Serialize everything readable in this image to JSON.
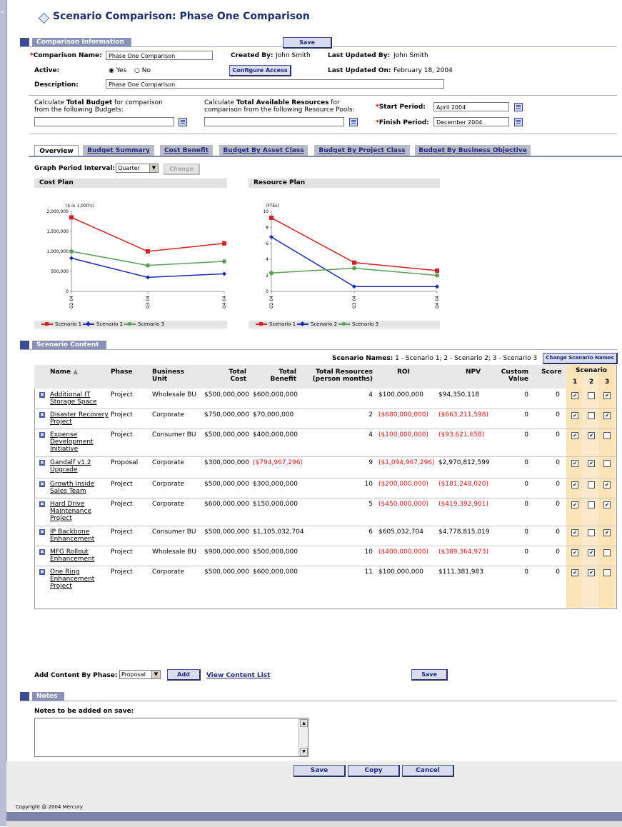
{
  "page": {
    "title": "Scenario Comparison: Phase One Comparison"
  },
  "comparison_info": {
    "header": "Comparison Information",
    "save": "Save",
    "name_label": "Comparison Name:",
    "name_value": "Phase One Comparison",
    "created_by_label": "Created By:",
    "created_by_value": "John Smith",
    "last_updated_by_label": "Last Updated By:",
    "last_updated_by_value": "John Smith",
    "active_label": "Active:",
    "active_yes": "Yes",
    "active_no": "No",
    "configure_access": "Configure Access",
    "last_updated_on_label": "Last Updated On:",
    "last_updated_on_value": "February 18, 2004",
    "description_label": "Description:",
    "description_value": "Phase One Comparison"
  },
  "budget": {
    "budget_text_pre": "Calculate ",
    "budget_text_bold": "Total Budget",
    "budget_text_post": " for comparison",
    "budget_text_line2": "from the following Budgets:",
    "res_text_pre": "Calculate ",
    "res_text_bold": "Total Available Resources",
    "res_text_post": " for",
    "res_text_line2": "comparison from the following Resource Pools:",
    "start_label": "Start Period:",
    "start_value": "April 2004",
    "finish_label": "Finish Period:",
    "finish_value": "December 2004"
  },
  "tabs": [
    "Overview",
    "Budget Summary",
    "Cost Benefit",
    "Budget By Asset Class",
    "Budget By Project Class",
    "Budget By Business Objective"
  ],
  "graph_interval": {
    "label": "Graph Period Interval:",
    "value": "Quarter",
    "change": "Change"
  },
  "chart_data": [
    {
      "type": "line",
      "title": "Cost Plan",
      "ylabel": "($ in 1,000's)",
      "categories": [
        "Q2 04",
        "Q3 04",
        "Q4 04"
      ],
      "yticks": [
        "0",
        "500,000",
        "1,000,000",
        "1,500,000",
        "2,000,000"
      ],
      "ylim": [
        0,
        2000000
      ],
      "series": [
        {
          "name": "Scenario 1",
          "color": "#d21f1f",
          "values": [
            1850000,
            1000000,
            1200000
          ]
        },
        {
          "name": "Scenario 2",
          "color": "#1a2bb0",
          "values": [
            830000,
            350000,
            440000
          ]
        },
        {
          "name": "Scenario 3",
          "color": "#5a9e5a",
          "values": [
            1000000,
            650000,
            750000
          ]
        }
      ]
    },
    {
      "type": "line",
      "title": "Resource Plan",
      "ylabel": "(FTEs)",
      "categories": [
        "Q2 04",
        "Q3 04",
        "Q4 04"
      ],
      "yticks": [
        "0",
        "2",
        "4",
        "6",
        "8",
        "10"
      ],
      "ylim": [
        0,
        10
      ],
      "series": [
        {
          "name": "Scenario 1",
          "color": "#d21f1f",
          "values": [
            9.2,
            3.6,
            2.6
          ]
        },
        {
          "name": "Scenario 2",
          "color": "#1a2bb0",
          "values": [
            6.8,
            0.6,
            0.6
          ]
        },
        {
          "name": "Scenario 3",
          "color": "#5a9e5a",
          "values": [
            2.3,
            2.9,
            2.0
          ]
        }
      ]
    }
  ],
  "scenario_content": {
    "header": "Scenario Content",
    "names_label": "Scenario Names:",
    "names_value": "1 - Scenario 1; 2 - Scenario 2; 3 - Scenario 3",
    "change_names": "Change Scenario Names",
    "columns": {
      "name": "Name",
      "phase": "Phase",
      "bu1": "Business",
      "bu2": "Unit",
      "tc1": "Total",
      "tc2": "Cost",
      "tb1": "Total",
      "tb2": "Benefit",
      "tr1": "Total Resources",
      "tr2": "(person months)",
      "roi": "ROI",
      "npv": "NPV",
      "cv1": "Custom",
      "cv2": "Value",
      "score": "Score",
      "scenario": "Scenario",
      "s1": "1",
      "s2": "2",
      "s3": "3"
    },
    "rows": [
      {
        "name": [
          "Additional IT",
          "Storage Space"
        ],
        "phase": "Project",
        "bu": "Wholesale BU",
        "cost": "$500,000,000",
        "benefit": "$600,000,000",
        "benefit_neg": false,
        "res": "4",
        "roi": "$100,000,000",
        "roi_neg": false,
        "npv": "$94,350,118",
        "npv_neg": false,
        "cv": "0",
        "score": "0",
        "s": [
          true,
          false,
          true
        ]
      },
      {
        "name": [
          "Disaster Recovery",
          "Project"
        ],
        "phase": "Project",
        "bu": "Corporate",
        "cost": "$750,000,000",
        "benefit": "$70,000,000",
        "benefit_neg": false,
        "res": "2",
        "roi": "($680,000,000)",
        "roi_neg": true,
        "npv": "($663,211,598)",
        "npv_neg": true,
        "cv": "0",
        "score": "0",
        "s": [
          true,
          false,
          true
        ]
      },
      {
        "name": [
          "Expense",
          "Development",
          "Initiative"
        ],
        "phase": "Project",
        "bu": "Consumer BU",
        "cost": "$500,000,000",
        "benefit": "$400,000,000",
        "benefit_neg": false,
        "res": "4",
        "roi": "($100,000,000)",
        "roi_neg": true,
        "npv": "($93,621,658)",
        "npv_neg": true,
        "cv": "0",
        "score": "0",
        "s": [
          true,
          true,
          false
        ]
      },
      {
        "name": [
          "Gandalf v1.2",
          "Upgrade"
        ],
        "phase": "Proposal",
        "bu": "Corporate",
        "cost": "$300,000,000",
        "benefit": "($794,967,296)",
        "benefit_neg": true,
        "res": "9",
        "roi": "($1,094,967,296)",
        "roi_neg": true,
        "npv": "$2,970,812,599",
        "npv_neg": false,
        "cv": "0",
        "score": "0",
        "s": [
          true,
          true,
          false
        ]
      },
      {
        "name": [
          "Growth Inside",
          "Sales Team"
        ],
        "phase": "Project",
        "bu": "Corporate",
        "cost": "$500,000,000",
        "benefit": "$300,000,000",
        "benefit_neg": false,
        "res": "10",
        "roi": "($200,000,000)",
        "roi_neg": true,
        "npv": "($181,248,020)",
        "npv_neg": true,
        "cv": "0",
        "score": "0",
        "s": [
          true,
          false,
          true
        ]
      },
      {
        "name": [
          "Hard Drive",
          "Maintenance",
          "Project"
        ],
        "phase": "Project",
        "bu": "Corporate",
        "cost": "$600,000,000",
        "benefit": "$150,000,000",
        "benefit_neg": false,
        "res": "5",
        "roi": "($450,000,000)",
        "roi_neg": true,
        "npv": "($419,392,901)",
        "npv_neg": true,
        "cv": "0",
        "score": "0",
        "s": [
          true,
          false,
          true
        ]
      },
      {
        "name": [
          "IP Backbone",
          "Enhancement"
        ],
        "phase": "Project",
        "bu": "Consumer BU",
        "cost": "$500,000,000",
        "benefit": "$1,105,032,704",
        "benefit_neg": false,
        "res": "6",
        "roi": "$605,032,704",
        "roi_neg": false,
        "npv": "$4,778,815,019",
        "npv_neg": false,
        "cv": "0",
        "score": "0",
        "s": [
          true,
          false,
          true
        ]
      },
      {
        "name": [
          "MFG Rollout",
          "Enhancement"
        ],
        "phase": "Project",
        "bu": "Wholesale BU",
        "cost": "$900,000,000",
        "benefit": "$500,000,000",
        "benefit_neg": false,
        "res": "10",
        "roi": "($400,000,000)",
        "roi_neg": true,
        "npv": "($389,364,973)",
        "npv_neg": true,
        "cv": "0",
        "score": "0",
        "s": [
          true,
          true,
          false
        ]
      },
      {
        "name": [
          "One Ring",
          "Enhancement",
          "Project"
        ],
        "phase": "Project",
        "bu": "Corporate",
        "cost": "$500,000,000",
        "benefit": "$600,000,000",
        "benefit_neg": false,
        "res": "11",
        "roi": "$100,000,000",
        "roi_neg": false,
        "npv": "$111,381,983",
        "npv_neg": false,
        "cv": "0",
        "score": "0",
        "s": [
          true,
          true,
          false
        ]
      }
    ],
    "add_label": "Add Content By Phase:",
    "add_value": "Proposal",
    "add_button": "Add",
    "view_list": "View Content List",
    "save": "Save"
  },
  "notes": {
    "header": "Notes",
    "label": "Notes to be added on save:",
    "save": "Save",
    "copy": "Copy",
    "cancel": "Cancel"
  },
  "copyright": "Copyright @ 2004 Mercury"
}
